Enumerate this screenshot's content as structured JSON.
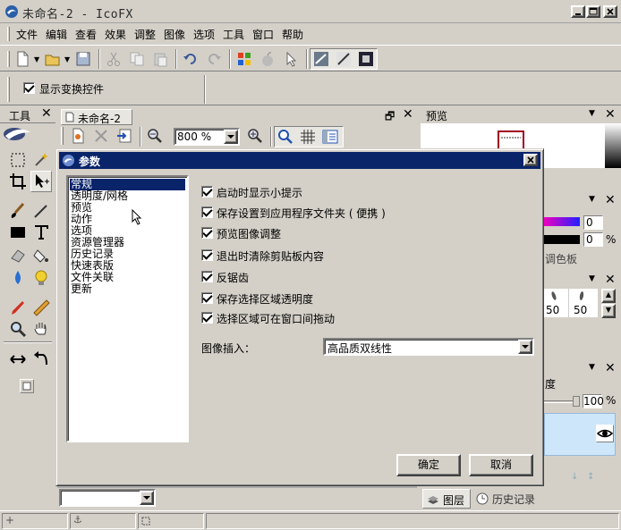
{
  "window": {
    "title": "未命名-2 - IcoFX"
  },
  "menu": [
    "文件",
    "编辑",
    "查看",
    "效果",
    "调整",
    "图像",
    "选项",
    "工具",
    "窗口",
    "帮助"
  ],
  "transform_bar": {
    "show_transform_controls": "显示变换控件"
  },
  "tools_panel": {
    "title": "工具"
  },
  "document": {
    "tab": "未命名-2",
    "zoom": "800 %"
  },
  "preview_panel": {
    "title": "预览"
  },
  "color_panel": {
    "value_a": "0",
    "value_b": "0",
    "percent": "%",
    "palette_label": "调色板"
  },
  "brush_panel": {
    "size_a": "50",
    "size_b": "50"
  },
  "layers_panel": {
    "opacity_label": "度",
    "opacity_value": "100",
    "percent": "%"
  },
  "bottom_tabs": {
    "layers": "图层",
    "history": "历史记录"
  },
  "dialog": {
    "title": "参数",
    "categories": [
      "常规",
      "透明度/网格",
      "预览",
      "动作",
      "选项",
      "资源管理器",
      "历史记录",
      "快速表版",
      "文件关联",
      "更新"
    ],
    "selected_category": 0,
    "options": [
      "启动时显示小提示",
      "保存设置到应用程序文件夹 ( 便携 )",
      "预览图像调整",
      "退出时清除剪贴板内容",
      "反锯齿",
      "保存选择区域透明度",
      "选择区域可在窗口间拖动"
    ],
    "interpolation_label": "图像插入：",
    "interpolation_value": "高品质双线性",
    "ok": "确定",
    "cancel": "取消"
  },
  "colors": {
    "dialog_title_bg": "#0a246a",
    "selection": "#0a246a",
    "chrome": "#d4d0c8"
  }
}
